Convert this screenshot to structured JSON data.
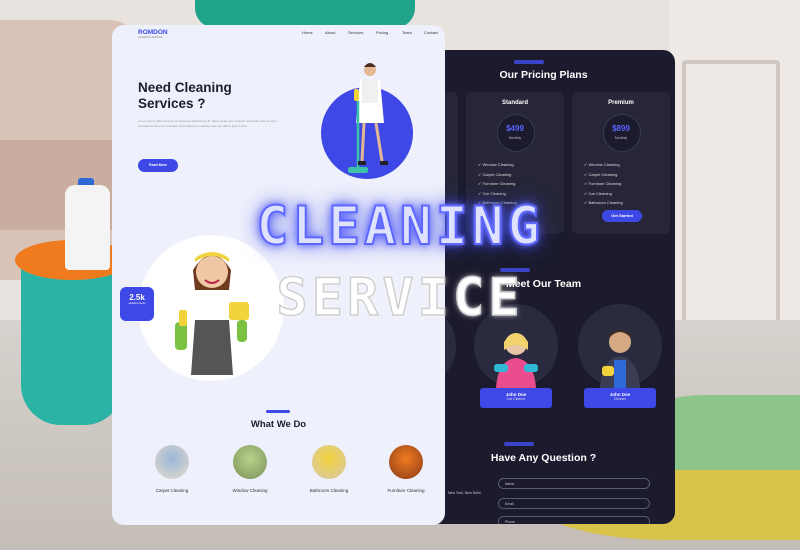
{
  "colors": {
    "accent": "#3e48e6",
    "dark_bg": "#1b1b2d",
    "light_bg": "#eef0fb"
  },
  "light": {
    "brand": "ROMDON",
    "brand_sub": "CLEANING SERVICE",
    "nav": [
      "Home",
      "About",
      "Services",
      "Pricing",
      "Team",
      "Contact"
    ],
    "hero_title": "Need Cleaning Services ?",
    "hero_text": "Lorem ipsum dolor sit amet consectetur adipisicing elit. Nemo quam eum deleniti reiciendis quas veniam accusamus laborum voluptate. Exercitationem adipisci quia. Ex officiis ipsum dolor.",
    "read_more": "Read More",
    "stat_num": "2.5k",
    "stat_label": "satisfied clients",
    "what_title": "What We Do",
    "services": [
      "Carpet Cleaning",
      "Window Cleaning",
      "Bathroom Cleaning",
      "Furniture Cleaning"
    ]
  },
  "dark": {
    "pricing_title": "Our Pricing Plans",
    "plans": [
      {
        "name": "Standard",
        "price": "$499",
        "period": "Monthly",
        "features": [
          "Window Cleaning",
          "Carpet Cleaning",
          "Furniture Cleaning",
          "Car Cleaning",
          "Bathroom Cleaning"
        ],
        "button": "Get Started"
      },
      {
        "name": "Premium",
        "price": "$899",
        "period": "Monthly",
        "features": [
          "Window Cleaning",
          "Carpet Cleaning",
          "Furniture Cleaning",
          "Car Cleaning",
          "Bathroom Cleaning"
        ],
        "button": "Get Started"
      }
    ],
    "team_title": "Meet Our Team",
    "team": [
      {
        "name": "John Doe",
        "role": "Car Cleaner"
      },
      {
        "name": "John Doe",
        "role": "Cleaner"
      }
    ],
    "question_title": "Have Any Question ?",
    "address": "New York, New Delhi",
    "fields": [
      "Name",
      "Email",
      "Phone"
    ]
  },
  "overlay": {
    "line1": "CLEANING",
    "line2": "SERVICE"
  }
}
